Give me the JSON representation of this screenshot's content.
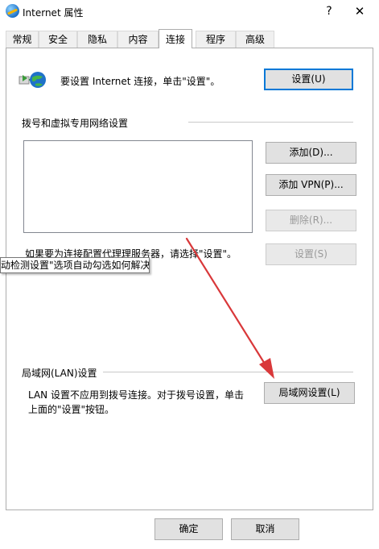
{
  "window": {
    "title": "Internet 属性",
    "help": "?",
    "close": "✕"
  },
  "tabs": [
    "常规",
    "安全",
    "隐私",
    "内容",
    "连接",
    "程序",
    "高级"
  ],
  "active_tab": "连接",
  "setup": {
    "text": "要设置 Internet 连接，单击\"设置\"。",
    "button": "设置(U)"
  },
  "dialup": {
    "group_label": "拨号和虚拟专用网络设置",
    "add_button": "添加(D)...",
    "add_vpn_button": "添加 VPN(P)...",
    "remove_button": "删除(R)...",
    "proxy_text": "如果要为连接配置代理理服务器，请选择\"设置\"。",
    "settings_button": "设置(S)"
  },
  "tooltip": "动检测设置\"选项自动勾选如何解决",
  "lan": {
    "group_label": "局域网(LAN)设置",
    "text_line1": "LAN 设置不应用到拨号连接。对于拨号设置，单击",
    "text_line2": "上面的\"设置\"按钮。",
    "button": "局域网设置(L)"
  },
  "footer": {
    "ok": "确定",
    "cancel": "取消"
  },
  "colors": {
    "accent": "#0078d7",
    "arrow": "#d9383a"
  }
}
